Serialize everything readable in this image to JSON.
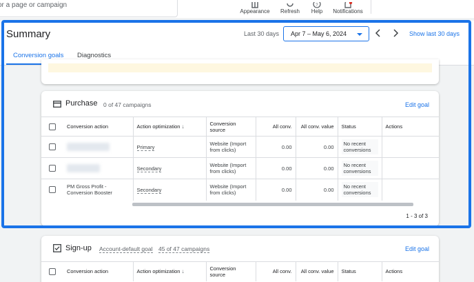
{
  "topbar": {
    "search_placeholder": "or a page or campaign",
    "items": [
      {
        "label": "Appearance",
        "icon": "appearance-icon"
      },
      {
        "label": "Refresh",
        "icon": "refresh-icon"
      },
      {
        "label": "Help",
        "icon": "help-icon"
      },
      {
        "label": "Notifications",
        "icon": "notifications-icon"
      }
    ]
  },
  "header": {
    "title": "Summary",
    "range_label": "Last 30 days",
    "date_range": "Apr 7 – May 6, 2024",
    "show_last_link": "Show last 30 days"
  },
  "tabs": [
    {
      "label": "Conversion goals",
      "active": true
    },
    {
      "label": "Diagnostics",
      "active": false
    }
  ],
  "purchase_card": {
    "title": "Purchase",
    "subtitle": "0 of 47 campaigns",
    "edit_label": "Edit goal",
    "columns": [
      "Conversion action",
      "Action optimization",
      "Conversion source",
      "All conv.",
      "All conv. value",
      "Status",
      "Actions"
    ],
    "rows": [
      {
        "name": "",
        "optimization": "Primary",
        "source": "Website (Import from clicks)",
        "all_conv": "0.00",
        "all_conv_value": "0.00",
        "status": "No recent conversions"
      },
      {
        "name": "",
        "optimization": "Secondary",
        "source": "Website (Import from clicks)",
        "all_conv": "0.00",
        "all_conv_value": "0.00",
        "status": "No recent conversions"
      },
      {
        "name": "PM Gross Profit - Conversion Booster",
        "optimization": "Secondary",
        "source": "Website (Import from clicks)",
        "all_conv": "0.00",
        "all_conv_value": "0.00",
        "status": "No recent conversions"
      }
    ],
    "pager": "1 - 3 of 3"
  },
  "signup_card": {
    "title": "Sign-up",
    "account_default": "Account-default goal",
    "campaigns": "45 of 47 campaigns",
    "edit_label": "Edit goal",
    "columns": [
      "Conversion action",
      "Action optimization",
      "Conversion source",
      "All conv.",
      "All conv. value",
      "Status",
      "Actions"
    ]
  },
  "colors": {
    "accent": "#1a73e8",
    "notification_dot": "#d93025"
  }
}
